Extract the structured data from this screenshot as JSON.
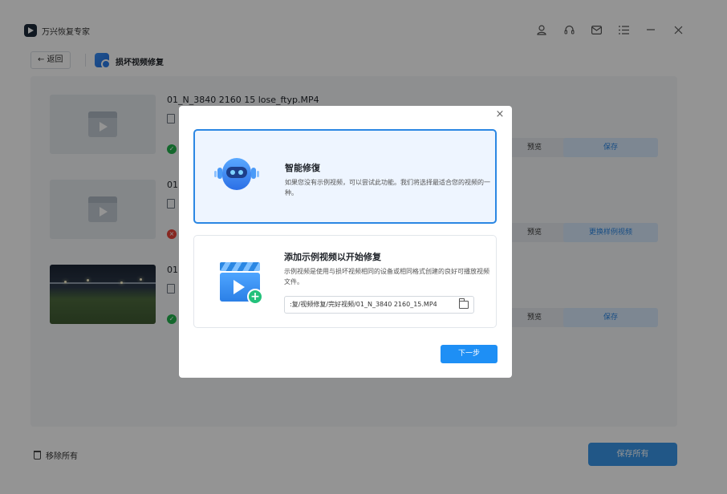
{
  "app": {
    "title": "万兴恢复专家",
    "titlebar_icons": [
      "user-icon",
      "headset-icon",
      "mail-icon",
      "menu-icon",
      "minimize-icon",
      "close-icon"
    ]
  },
  "subheader": {
    "back_label": "← 返回",
    "feature_title": "损坏视频修复"
  },
  "videos": [
    {
      "name": "01_N_3840 2160 15 lose_ftyp.MP4",
      "status": "ok",
      "preview_label": "预览",
      "action_label": "保存"
    },
    {
      "name": "01",
      "status": "error",
      "preview_label": "预览",
      "action_label": "更换样例视频"
    },
    {
      "name": "01",
      "status": "ok",
      "preview_label": "预览",
      "action_label": "保存"
    }
  ],
  "bottom": {
    "remove_all_label": "移除所有",
    "save_all_label": "保存所有"
  },
  "modal": {
    "close_glyph": "×",
    "smart_repair": {
      "title": "智能修復",
      "description": "如果您没有示例视频，可以尝试此功能。我们将选择最适合您的视频的一种。"
    },
    "sample_repair": {
      "title": "添加示例视频以开始修复",
      "description": "示例视频是使用与损坏视频相同的设备或相同格式创建的良好可播放视频文件。",
      "path_value": ":复/视频修复/完好视频/01_N_3840 2160_15.MP4"
    },
    "next_label": "下一步"
  },
  "colors": {
    "accent": "#1e8ff5",
    "selected_border": "#2b87e3",
    "success": "#22b14c",
    "error": "#e8453c",
    "overlay": "rgba(0,0,0,0.42)"
  }
}
